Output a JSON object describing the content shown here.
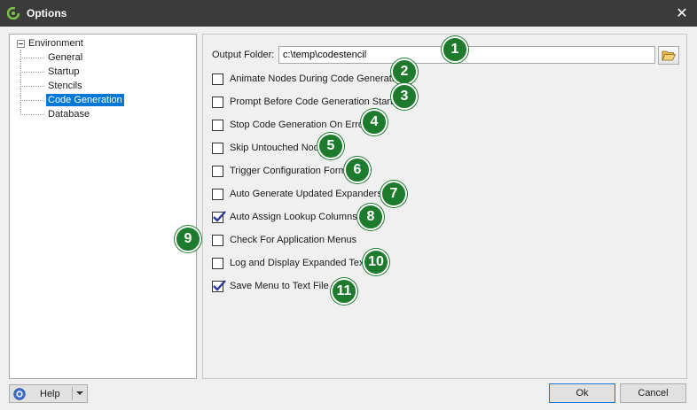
{
  "window": {
    "title": "Options",
    "close_glyph": "✕"
  },
  "tree": {
    "root": "Environment",
    "items": [
      {
        "label": "General",
        "selected": false
      },
      {
        "label": "Startup",
        "selected": false
      },
      {
        "label": "Stencils",
        "selected": false
      },
      {
        "label": "Code Generation",
        "selected": true
      },
      {
        "label": "Database",
        "selected": false
      }
    ]
  },
  "output_folder": {
    "label": "Output Folder:",
    "value": "c:\\temp\\codestencil"
  },
  "options": [
    {
      "label": "Animate Nodes During Code Generation",
      "checked": false
    },
    {
      "label": "Prompt Before Code Generation Starts",
      "checked": false
    },
    {
      "label": "Stop Code Generation On Error",
      "checked": false
    },
    {
      "label": "Skip Untouched Nodes",
      "checked": false
    },
    {
      "label": "Trigger Configuration Form",
      "checked": false
    },
    {
      "label": "Auto Generate Updated Expanders",
      "checked": false
    },
    {
      "label": "Auto Assign Lookup Columns",
      "checked": true
    },
    {
      "label": "Check For Application Menus",
      "checked": false
    },
    {
      "label": "Log and Display Expanded Text",
      "checked": false
    },
    {
      "label": "Save Menu to Text File",
      "checked": true
    }
  ],
  "badges": [
    "1",
    "2",
    "3",
    "4",
    "5",
    "6",
    "7",
    "8",
    "9",
    "10",
    "11"
  ],
  "footer": {
    "help": "Help",
    "ok": "Ok",
    "cancel": "Cancel"
  },
  "colors": {
    "badge": "#1e7b2e",
    "selection": "#0078d7",
    "titlebar": "#3b3b3b"
  }
}
